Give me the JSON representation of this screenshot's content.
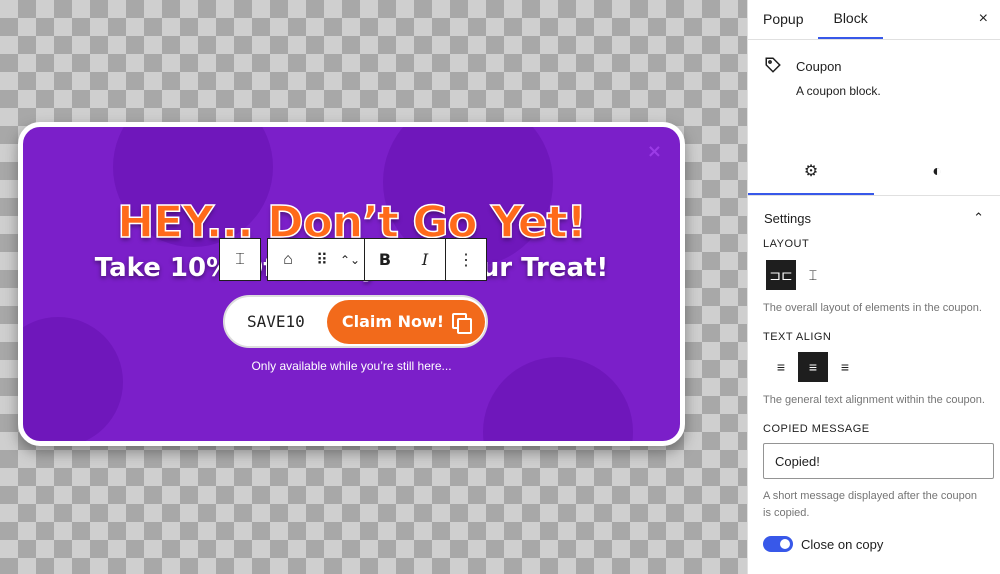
{
  "popup": {
    "close": "×",
    "headline": "HEY... Don’t Go Yet!",
    "subhead": "Take 10% Off Today – On Our Treat!",
    "coupon_code": "SAVE10",
    "claim_label": "Claim Now!",
    "note": "Only available while you’re still here...",
    "colors": {
      "background": "#7b1fc9",
      "accent": "#f26a1b",
      "headline": "#ff6a1a"
    }
  },
  "toolbar": {
    "layout_icon": "⌶",
    "tag_icon": "⌂",
    "drag_icon": "⠿",
    "move_icon": "⌃⌄",
    "bold": "B",
    "italic": "I",
    "more": "⋮"
  },
  "sidebar": {
    "tabs": [
      {
        "label": "Popup"
      },
      {
        "label": "Block"
      }
    ],
    "close": "×",
    "block": {
      "icon": "tag-icon",
      "title": "Coupon",
      "description": "A coupon block."
    },
    "subtabs": {
      "settings_icon": "⚙",
      "styles_icon": "◐"
    },
    "panel": {
      "title": "Settings",
      "chevron": "⌃",
      "layout_label": "LAYOUT",
      "layout_options": [
        "⊐⊏",
        "⌶"
      ],
      "layout_help": "The overall layout of elements in the coupon.",
      "text_align_label": "TEXT ALIGN",
      "text_align_options": [
        "≡",
        "≡",
        "≡"
      ],
      "text_align_help": "The general text alignment within the coupon.",
      "copied_label": "COPIED MESSAGE",
      "copied_value": "Copied!",
      "copied_help": "A short message displayed after the coupon is copied.",
      "close_on_copy_label": "Close on copy",
      "close_on_copy": true
    },
    "accent": "#3858e9"
  }
}
